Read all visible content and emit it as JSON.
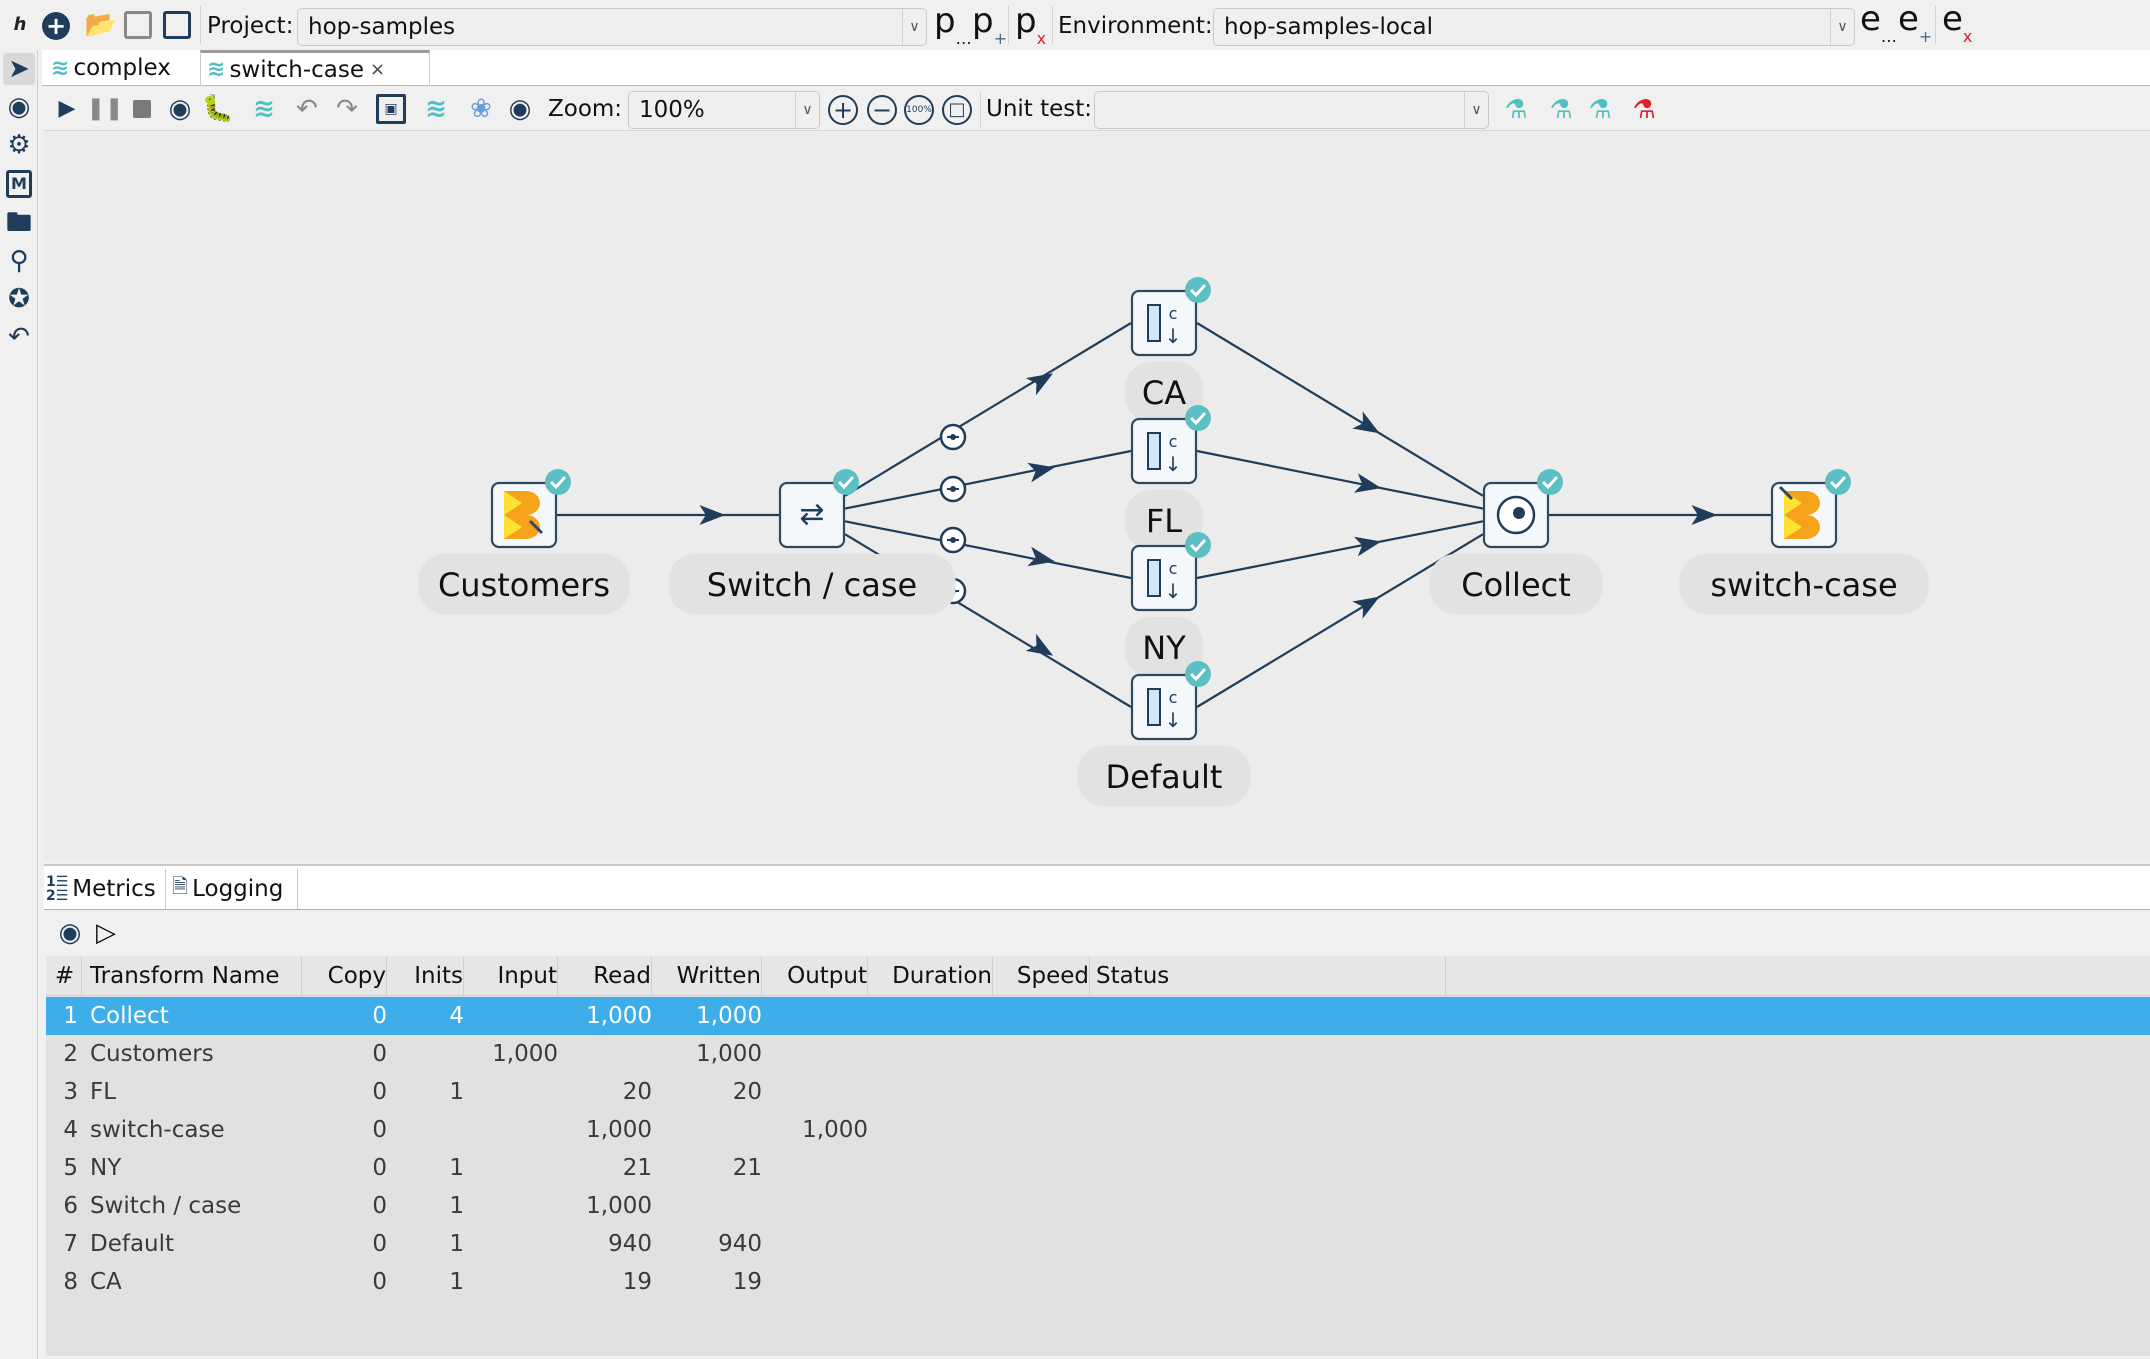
{
  "topbar": {
    "project_label": "Project:",
    "project_value": "hop-samples",
    "environment_label": "Environment:",
    "environment_value": "hop-samples-local",
    "project_icons": [
      "project-edit-icon",
      "project-add-icon",
      "project-delete-icon"
    ],
    "environment_icons": [
      "environment-edit-icon",
      "environment-add-icon",
      "environment-delete-icon"
    ]
  },
  "tabs": [
    {
      "label": "complex",
      "active": false
    },
    {
      "label": "switch-case",
      "active": true,
      "close": "×"
    }
  ],
  "toolbar": {
    "zoom_label": "Zoom:",
    "zoom_value": "100%",
    "zoom_100_label": "100%",
    "unit_test_label": "Unit test:",
    "unit_test_value": ""
  },
  "pipeline": {
    "nodes": [
      {
        "name": "Customers",
        "type": "input"
      },
      {
        "name": "Switch / case",
        "type": "switch"
      },
      {
        "name": "CA",
        "type": "select-values"
      },
      {
        "name": "FL",
        "type": "select-values"
      },
      {
        "name": "NY",
        "type": "select-values"
      },
      {
        "name": "Default",
        "type": "select-values"
      },
      {
        "name": "Collect",
        "type": "dummy"
      },
      {
        "name": "switch-case",
        "type": "output"
      }
    ],
    "status_color": "#5bbfc4",
    "hop_color": "#1f3d5a"
  },
  "bottom": {
    "tabs": [
      {
        "label": "Metrics"
      },
      {
        "label": "Logging"
      }
    ],
    "columns": [
      "#",
      "Transform Name",
      "Copy",
      "Inits",
      "Input",
      "Read",
      "Written",
      "Output",
      "Duration",
      "Speed",
      "Status"
    ],
    "rows": [
      [
        "1",
        "Collect",
        "0",
        "4",
        "",
        "1,000",
        "1,000",
        "",
        "",
        "",
        ""
      ],
      [
        "2",
        "Customers",
        "0",
        "",
        "1,000",
        "",
        "1,000",
        "",
        "",
        "",
        ""
      ],
      [
        "3",
        "FL",
        "0",
        "1",
        "",
        "20",
        "20",
        "",
        "",
        "",
        ""
      ],
      [
        "4",
        "switch-case",
        "0",
        "",
        "",
        "1,000",
        "",
        "1,000",
        "",
        "",
        ""
      ],
      [
        "5",
        "NY",
        "0",
        "1",
        "",
        "21",
        "21",
        "",
        "",
        "",
        ""
      ],
      [
        "6",
        "Switch / case",
        "0",
        "1",
        "",
        "1,000",
        "",
        "",
        "",
        "",
        ""
      ],
      [
        "7",
        "Default",
        "0",
        "1",
        "",
        "940",
        "940",
        "",
        "",
        "",
        ""
      ],
      [
        "8",
        "CA",
        "0",
        "1",
        "",
        "19",
        "19",
        "",
        "",
        "",
        ""
      ]
    ],
    "selected_row": 0,
    "selection_color": "#3daee9"
  }
}
